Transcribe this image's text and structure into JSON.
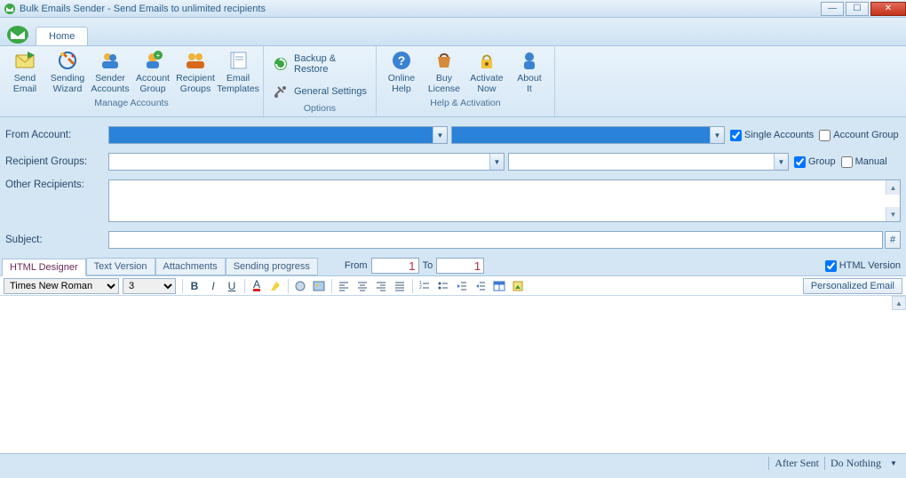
{
  "title": "Bulk Emails Sender - Send Emails to unlimited recipients",
  "home_tab": "Home",
  "ribbon": {
    "group1": {
      "label": "Manage Accounts",
      "btns": {
        "send": "Send\nEmail",
        "wizard": "Sending\nWizard",
        "sender": "Sender\nAccounts",
        "agroup": "Account\nGroup",
        "rgroups": "Recipient\nGroups",
        "templates": "Email\nTemplates"
      }
    },
    "group2": {
      "label": "Options",
      "rows": {
        "backup": "Backup &\nRestore",
        "settings": "General Settings"
      }
    },
    "group3": {
      "label": "Help & Activation",
      "btns": {
        "help": "Online\nHelp",
        "buy": "Buy\nLicense",
        "activate": "Activate\nNow",
        "about": "About\nIt"
      }
    }
  },
  "form": {
    "from_label": "From Account:",
    "recip_label": "Recipient Groups:",
    "other_label": "Other Recipients:",
    "subject_label": "Subject:",
    "single_accounts": "Single Accounts",
    "account_group": "Account Group",
    "group": "Group",
    "manual": "Manual"
  },
  "tabs": {
    "designer": "HTML Designer",
    "text": "Text Version",
    "attach": "Attachments",
    "progress": "Sending progress",
    "from": "From",
    "to": "To",
    "from_val": "1",
    "to_val": "1",
    "html_version": "HTML Version"
  },
  "editor": {
    "font": "Times New Roman",
    "size": "3",
    "personalized": "Personalized Email"
  },
  "bottom": {
    "after_sent": "After Sent",
    "do_nothing": "Do Nothing"
  }
}
